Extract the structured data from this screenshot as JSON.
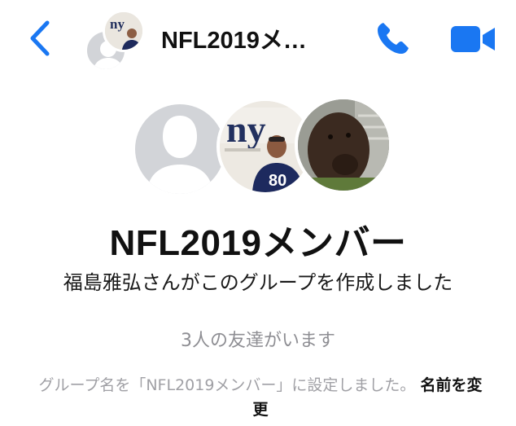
{
  "header": {
    "title": "NFL2019メ…",
    "back_icon": "chevron-left-icon",
    "call_icon": "phone-icon",
    "video_icon": "video-camera-icon",
    "accent_color": "#1a77f2"
  },
  "group": {
    "name": "NFL2019メンバー",
    "created_message": "福島雅弘さんがこのグループを作成しました",
    "friends_count": "3人の友達がいます",
    "rename_message": "グループ名を「NFL2019メンバー」に設定しました。",
    "rename_link": "名前を変更",
    "photo_logo_text": "ny",
    "jersey_number": "80"
  }
}
